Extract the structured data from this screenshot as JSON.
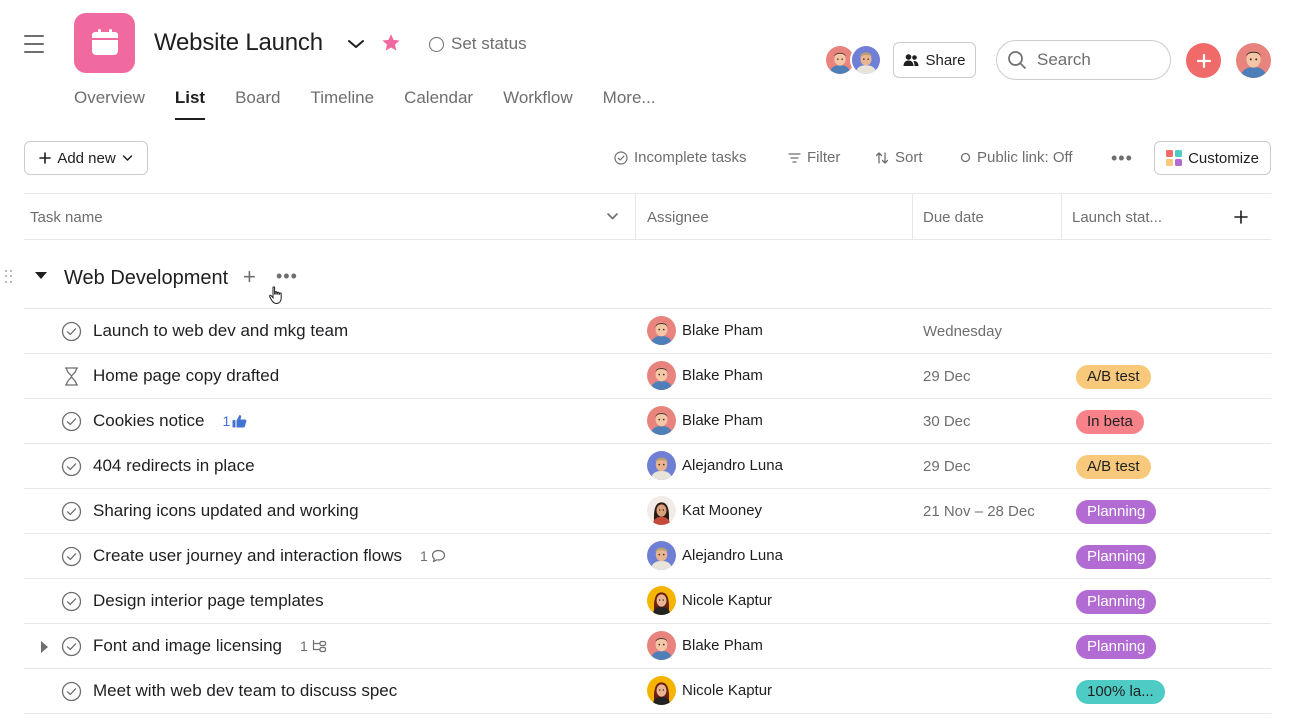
{
  "header": {
    "project_title": "Website Launch",
    "set_status_label": "Set status",
    "share_label": "Share",
    "search_placeholder": "Search",
    "project_color": "#f06a9f",
    "star_color": "#f06a9f",
    "add_button_color": "#f06a6a"
  },
  "tabs": [
    {
      "label": "Overview",
      "active": false
    },
    {
      "label": "List",
      "active": true
    },
    {
      "label": "Board",
      "active": false
    },
    {
      "label": "Timeline",
      "active": false
    },
    {
      "label": "Calendar",
      "active": false
    },
    {
      "label": "Workflow",
      "active": false
    },
    {
      "label": "More...",
      "active": false
    }
  ],
  "toolbar": {
    "add_new_label": "Add new",
    "incomplete_tasks_label": "Incomplete tasks",
    "filter_label": "Filter",
    "sort_label": "Sort",
    "public_link_label": "Public link: Off",
    "customize_label": "Customize"
  },
  "columns": {
    "task_name": "Task name",
    "assignee": "Assignee",
    "due_date": "Due date",
    "launch_status": "Launch stat..."
  },
  "section": {
    "title": "Web Development"
  },
  "tasks": [
    {
      "name": "Launch to web dev and mkg team",
      "icon": "check-circle-icon",
      "meta": "",
      "meta_icon": "",
      "assignee": "Blake Pham",
      "avatar": "blake",
      "due": "Wednesday",
      "status": "",
      "status_bg": "",
      "status_fg": "",
      "has_subtasks_caret": false
    },
    {
      "name": "Home page copy drafted",
      "icon": "hourglass-icon",
      "meta": "",
      "meta_icon": "",
      "assignee": "Blake Pham",
      "avatar": "blake",
      "due": "29 Dec",
      "status": "A/B test",
      "status_bg": "#f8c97b",
      "status_fg": "#1e1f21",
      "has_subtasks_caret": false
    },
    {
      "name": "Cookies notice",
      "icon": "check-circle-icon",
      "meta": "1",
      "meta_icon": "thumbs-up-icon",
      "assignee": "Blake Pham",
      "avatar": "blake",
      "due": "30 Dec",
      "status": "In beta",
      "status_bg": "#f7828a",
      "status_fg": "#1e1f21",
      "has_subtasks_caret": false
    },
    {
      "name": "404 redirects in place",
      "icon": "check-circle-icon",
      "meta": "",
      "meta_icon": "",
      "assignee": "Alejandro Luna",
      "avatar": "alejandro",
      "due": "29 Dec",
      "status": "A/B test",
      "status_bg": "#f8c97b",
      "status_fg": "#1e1f21",
      "has_subtasks_caret": false
    },
    {
      "name": "Sharing icons updated and working",
      "icon": "check-circle-icon",
      "meta": "",
      "meta_icon": "",
      "assignee": "Kat Mooney",
      "avatar": "kat",
      "due": "21 Nov – 28 Dec",
      "status": "Planning",
      "status_bg": "#b36bd4",
      "status_fg": "#ffffff",
      "has_subtasks_caret": false
    },
    {
      "name": "Create user journey and interaction flows",
      "icon": "check-circle-icon",
      "meta": "1",
      "meta_icon": "comment-icon",
      "assignee": "Alejandro Luna",
      "avatar": "alejandro",
      "due": "",
      "status": "Planning",
      "status_bg": "#b36bd4",
      "status_fg": "#ffffff",
      "has_subtasks_caret": false
    },
    {
      "name": "Design interior page templates",
      "icon": "check-circle-icon",
      "meta": "",
      "meta_icon": "",
      "assignee": "Nicole Kaptur",
      "avatar": "nicole",
      "due": "",
      "status": "Planning",
      "status_bg": "#b36bd4",
      "status_fg": "#ffffff",
      "has_subtasks_caret": false
    },
    {
      "name": "Font and image licensing",
      "icon": "check-circle-icon",
      "meta": "1",
      "meta_icon": "subtask-icon",
      "assignee": "Blake Pham",
      "avatar": "blake",
      "due": "",
      "status": "Planning",
      "status_bg": "#b36bd4",
      "status_fg": "#ffffff",
      "has_subtasks_caret": true
    },
    {
      "name": "Meet with web dev team to discuss spec",
      "icon": "check-circle-icon",
      "meta": "",
      "meta_icon": "",
      "assignee": "Nicole Kaptur",
      "avatar": "nicole",
      "due": "",
      "status": "100% la...",
      "status_bg": "#4ecbc4",
      "status_fg": "#1e1f21",
      "has_subtasks_caret": false
    }
  ]
}
